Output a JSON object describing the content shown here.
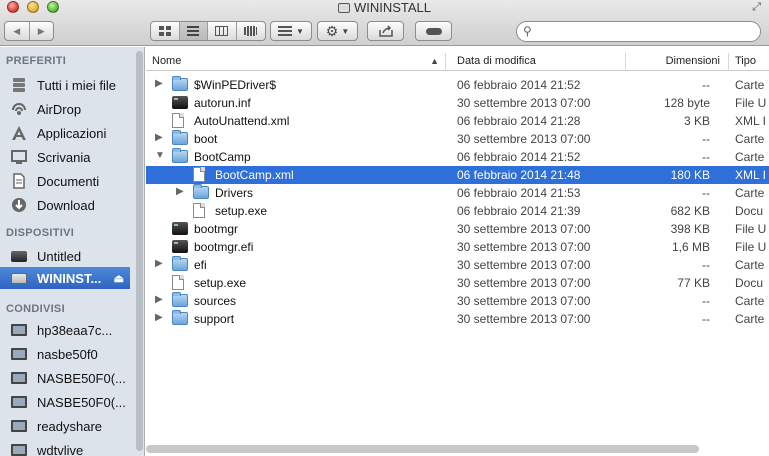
{
  "window": {
    "title": "WININSTALL"
  },
  "toolbar": {
    "back_label": "◀",
    "forward_label": "▶",
    "view_icons": [
      "icon-view-icon",
      "list-view-icon",
      "column-view-icon",
      "coverflow-view-icon"
    ],
    "arrange_icon": "arrange-icon",
    "action_icon": "gear-icon",
    "share_icon": "share-icon",
    "tag_icon": "tag-icon",
    "search_placeholder": ""
  },
  "sidebar": {
    "sections": [
      {
        "header": "PREFERITI",
        "items": [
          {
            "label": "Tutti i miei file",
            "icon": "all-files-icon"
          },
          {
            "label": "AirDrop",
            "icon": "airdrop-icon"
          },
          {
            "label": "Applicazioni",
            "icon": "applications-icon"
          },
          {
            "label": "Scrivania",
            "icon": "desktop-icon"
          },
          {
            "label": "Documenti",
            "icon": "documents-icon"
          },
          {
            "label": "Download",
            "icon": "download-icon"
          }
        ]
      },
      {
        "header": "DISPOSITIVI",
        "items": [
          {
            "label": "Untitled",
            "icon": "disk-icon"
          },
          {
            "label": "WININST...",
            "icon": "drive-icon",
            "selected": true
          }
        ]
      },
      {
        "header": "CONDIVISI",
        "items": [
          {
            "label": "hp38eaa7c...",
            "icon": "screen-icon"
          },
          {
            "label": "nasbe50f0",
            "icon": "screen-icon"
          },
          {
            "label": "NASBE50F0(...",
            "icon": "screen-icon"
          },
          {
            "label": "NASBE50F0(...",
            "icon": "screen-icon"
          },
          {
            "label": "readyshare",
            "icon": "screen-icon"
          },
          {
            "label": "wdtvlive",
            "icon": "screen-icon"
          }
        ]
      }
    ]
  },
  "columns": {
    "name": "Nome",
    "date": "Data di modifica",
    "size": "Dimensioni",
    "kind": "Tipo"
  },
  "files": [
    {
      "name": "$WinPEDriver$",
      "date": "06 febbraio 2014 21:52",
      "size": "--",
      "kind": "Carte",
      "type": "folder",
      "depth": 0,
      "disclosure": "closed"
    },
    {
      "name": "autorun.inf",
      "date": "30 settembre 2013 07:00",
      "size": "128 byte",
      "kind": "File U",
      "type": "exec",
      "depth": 0,
      "disclosure": "none"
    },
    {
      "name": "AutoUnattend.xml",
      "date": "06 febbraio 2014 21:28",
      "size": "3 KB",
      "kind": "XML I",
      "type": "doc",
      "depth": 0,
      "disclosure": "none"
    },
    {
      "name": "boot",
      "date": "30 settembre 2013 07:00",
      "size": "--",
      "kind": "Carte",
      "type": "folder",
      "depth": 0,
      "disclosure": "closed"
    },
    {
      "name": "BootCamp",
      "date": "06 febbraio 2014 21:52",
      "size": "--",
      "kind": "Carte",
      "type": "folder",
      "depth": 0,
      "disclosure": "open"
    },
    {
      "name": "BootCamp.xml",
      "date": "06 febbraio 2014 21:48",
      "size": "180 KB",
      "kind": "XML I",
      "type": "doc",
      "depth": 1,
      "disclosure": "none",
      "selected": true
    },
    {
      "name": "Drivers",
      "date": "06 febbraio 2014 21:53",
      "size": "--",
      "kind": "Carte",
      "type": "folder",
      "depth": 1,
      "disclosure": "closed"
    },
    {
      "name": "setup.exe",
      "date": "06 febbraio 2014 21:39",
      "size": "682 KB",
      "kind": "Docu",
      "type": "doc",
      "depth": 1,
      "disclosure": "none"
    },
    {
      "name": "bootmgr",
      "date": "30 settembre 2013 07:00",
      "size": "398 KB",
      "kind": "File U",
      "type": "exec",
      "depth": 0,
      "disclosure": "none"
    },
    {
      "name": "bootmgr.efi",
      "date": "30 settembre 2013 07:00",
      "size": "1,6 MB",
      "kind": "File U",
      "type": "exec",
      "depth": 0,
      "disclosure": "none"
    },
    {
      "name": "efi",
      "date": "30 settembre 2013 07:00",
      "size": "--",
      "kind": "Carte",
      "type": "folder",
      "depth": 0,
      "disclosure": "closed"
    },
    {
      "name": "setup.exe",
      "date": "30 settembre 2013 07:00",
      "size": "77 KB",
      "kind": "Docu",
      "type": "doc",
      "depth": 0,
      "disclosure": "none"
    },
    {
      "name": "sources",
      "date": "30 settembre 2013 07:00",
      "size": "--",
      "kind": "Carte",
      "type": "folder",
      "depth": 0,
      "disclosure": "closed"
    },
    {
      "name": "support",
      "date": "30 settembre 2013 07:00",
      "size": "--",
      "kind": "Carte",
      "type": "folder",
      "depth": 0,
      "disclosure": "closed"
    }
  ],
  "colors": {
    "sidebar_bg": "#dde3ea",
    "selection": "#2e6fd9",
    "folder": "#6aa6dc"
  }
}
